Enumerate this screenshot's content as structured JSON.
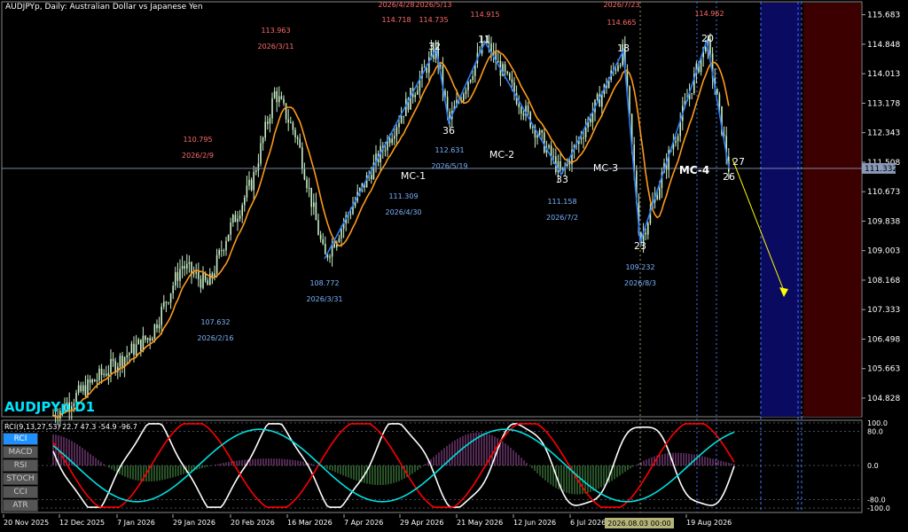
{
  "header": {
    "title": "AUDJPYp, Daily:  Australian Dollar vs Japanese Yen",
    "symbol_label": "AUDJPYp D1",
    "indicator_label": "RCI(9,13,27,53) 22.7 47.3 -54.9 -96.7"
  },
  "indicator_tabs": [
    {
      "label": "RCI",
      "active": true
    },
    {
      "label": "MACD",
      "active": false
    },
    {
      "label": "RSI",
      "active": false
    },
    {
      "label": "STOCH",
      "active": false
    },
    {
      "label": "CCI",
      "active": false
    },
    {
      "label": "ATR",
      "active": false
    }
  ],
  "chart_data": {
    "type": "line",
    "price_axis": {
      "ticks": [
        "115.683",
        "114.848",
        "114.013",
        "113.178",
        "112.343",
        "111.508",
        "110.673",
        "109.838",
        "109.003",
        "108.168",
        "107.333",
        "106.498",
        "105.663",
        "104.828"
      ],
      "min": 104.3,
      "max": 116.05,
      "current_price": "111.332"
    },
    "time_axis": [
      "20 Nov 2025",
      "12 Dec 2025",
      "7 Jan 2026",
      "29 Jan 2026",
      "20 Feb 2026",
      "16 Mar 2026",
      "7 Apr 2026",
      "29 Apr 2026",
      "21 May 2026",
      "12 Jun 2026",
      "6 Jul 2026",
      "19 Aug 2026"
    ],
    "time_cursor_label": "2026.08.03 00:00",
    "zigzag": [
      {
        "id": "start",
        "price": 108.772
      },
      {
        "id": "32",
        "price": 114.735
      },
      {
        "id": "36",
        "price": 112.631
      },
      {
        "id": "11",
        "price": 114.915
      },
      {
        "id": "33",
        "price": 111.158
      },
      {
        "id": "18",
        "price": 114.665
      },
      {
        "id": "23",
        "price": 109.232
      },
      {
        "id": "20",
        "price": 114.962
      },
      {
        "id": "26",
        "price": 111.332
      }
    ],
    "point_labels": [
      "32",
      "36",
      "11",
      "33",
      "18",
      "23",
      "20",
      "26",
      "27"
    ],
    "pattern_labels": [
      "MC-1",
      "MC-2",
      "MC-3",
      "MC-4"
    ],
    "annotations": [
      {
        "price": "113.963",
        "date": "2026/3/11",
        "color": "#ff6b6b"
      },
      {
        "price": "110.795",
        "date": "2026/2/9",
        "color": "#ff6b6b"
      },
      {
        "price": "114.718",
        "date": "2026/4/28",
        "color": "#ff6b6b"
      },
      {
        "price": "114.735",
        "date": "2026/5/13",
        "color": "#ff6b6b"
      },
      {
        "price": "114.915",
        "date": "",
        "color": "#ff6b6b"
      },
      {
        "price": "114.665",
        "date": "2026/7/23",
        "color": "#ff6b6b"
      },
      {
        "price": "114.962",
        "date": "",
        "color": "#ff6b6b"
      },
      {
        "price": "107.632",
        "date": "2026/2/16",
        "color": "#7ab4ff"
      },
      {
        "price": "108.772",
        "date": "2026/3/31",
        "color": "#7ab4ff"
      },
      {
        "price": "111.309",
        "date": "2026/4/30",
        "color": "#7ab4ff"
      },
      {
        "price": "112.631",
        "date": "2026/5/19",
        "color": "#7ab4ff"
      },
      {
        "price": "111.158",
        "date": "2026/7/2",
        "color": "#7ab4ff"
      },
      {
        "price": "109.232",
        "date": "2026/8/3",
        "color": "#7ab4ff"
      }
    ],
    "rci_axis": [
      "100.0",
      "80.0",
      "0.0",
      "-80.0",
      "-100.0"
    ],
    "colors": {
      "candle": "#c8f0c8",
      "moving_average": "#ff9a1a",
      "zigzag": "#2f7cf0",
      "forecast_arrow": "#ffff00",
      "zone_blue": "#0a0a60",
      "zone_red": "#3c0000",
      "rci_short": "#ffffff",
      "rci_mid": "#ff0000",
      "rci_long": "#00e0e0"
    }
  }
}
